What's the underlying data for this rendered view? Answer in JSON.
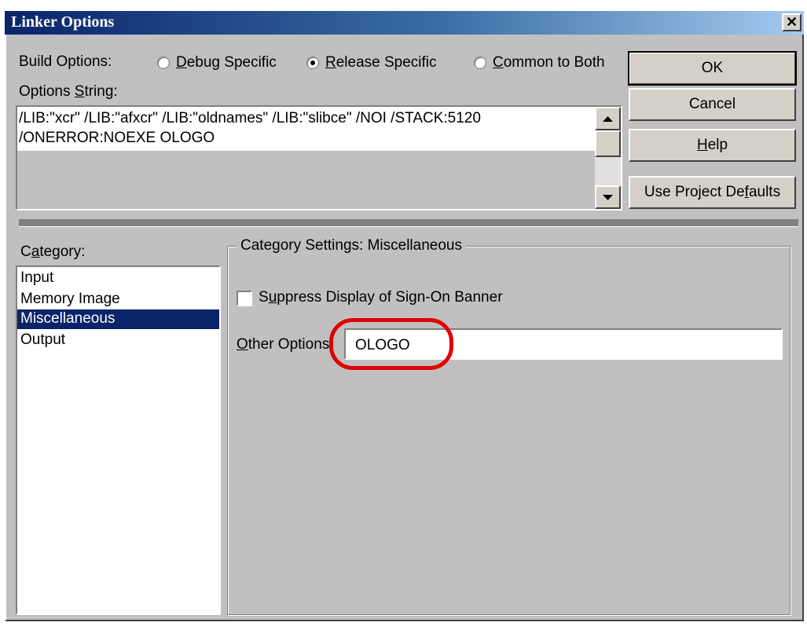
{
  "window": {
    "title": "Linker Options",
    "close_glyph": "✕"
  },
  "build_options": {
    "label": "Build Options:",
    "radios": [
      {
        "pre": "",
        "ul": "D",
        "post": "ebug Specific",
        "checked": false
      },
      {
        "pre": "",
        "ul": "R",
        "post": "elease Specific",
        "checked": true
      },
      {
        "pre": "",
        "ul": "C",
        "post": "ommon to Both",
        "checked": false
      }
    ]
  },
  "options_string": {
    "label_pre": "Options ",
    "label_ul": "S",
    "label_post": "tring:",
    "line1": "/LIB:\"xcr\" /LIB:\"afxcr\" /LIB:\"oldnames\" /LIB:\"slibce\" /NOI /STACK:5120",
    "line2": "/ONERROR:NOEXE OLOGO"
  },
  "buttons": {
    "ok": "OK",
    "cancel": "Cancel",
    "help_ul": "H",
    "help_post": "elp",
    "defaults_pre": "Use Project De",
    "defaults_ul": "f",
    "defaults_post": "aults"
  },
  "category": {
    "label_pre": "C",
    "label_ul": "a",
    "label_post": "tegory:",
    "items": [
      "Input",
      "Memory Image",
      "Miscellaneous",
      "Output"
    ],
    "selected_index": 2
  },
  "settings": {
    "group_title": "Category Settings: Miscellaneous",
    "suppress_pre": "S",
    "suppress_ul": "u",
    "suppress_post": "ppress Display of Sign-On Banner",
    "suppress_checked": false,
    "other_ul": "O",
    "other_post": "ther Options:",
    "other_value": "OLOGO"
  },
  "colors": {
    "titlebar_start": "#0a246a",
    "selection": "#0a246a",
    "annotation": "#e00000"
  }
}
